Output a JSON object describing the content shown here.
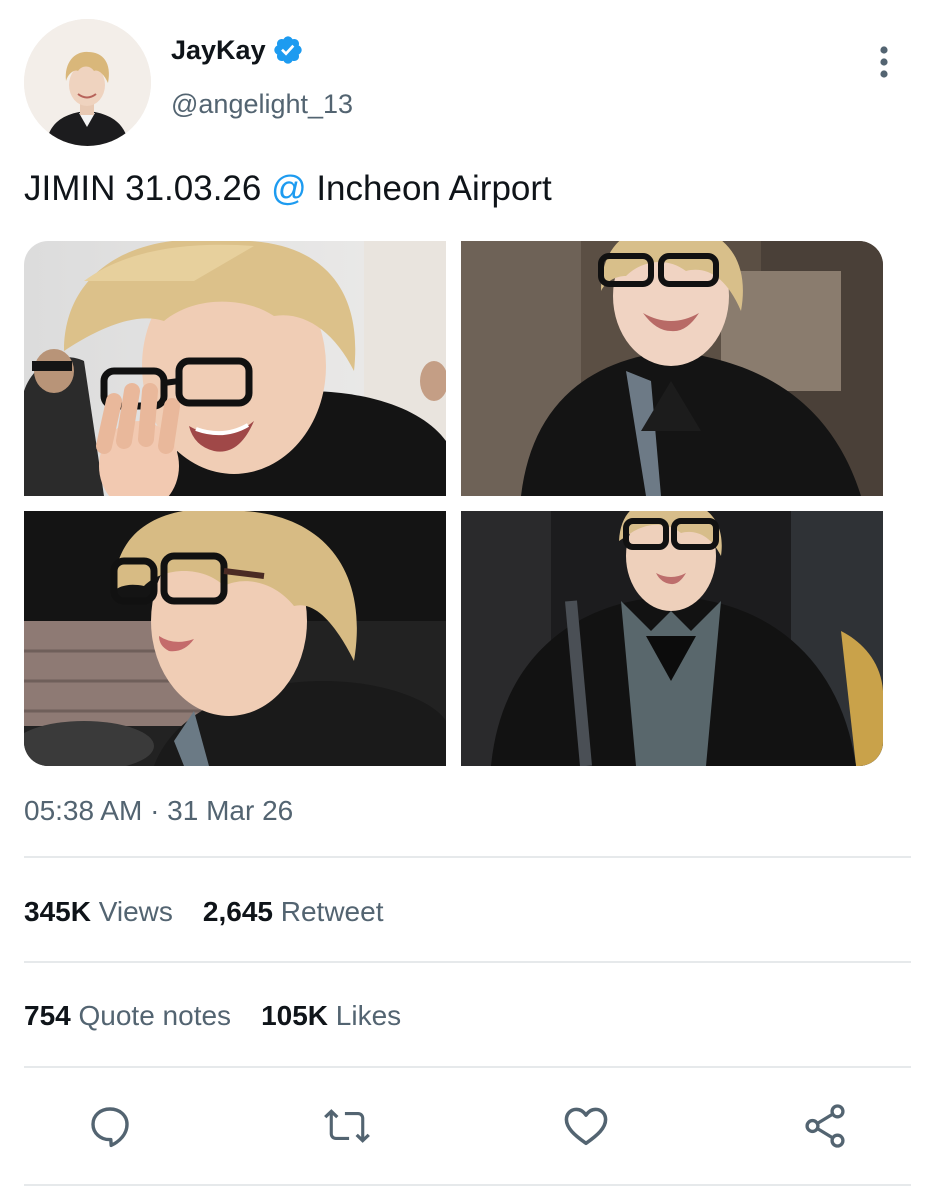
{
  "author": {
    "display_name": "JayKay",
    "handle": "@angelight_13",
    "verified": true
  },
  "tweet": {
    "text_before": "JIMIN 31.03.26 ",
    "at_symbol": "@",
    "text_after": " Incheon Airport",
    "timestamp": "05:38 AM · 31 Mar 26"
  },
  "media": [
    {
      "label": "photo-1"
    },
    {
      "label": "photo-2"
    },
    {
      "label": "photo-3"
    },
    {
      "label": "photo-4"
    }
  ],
  "stats": {
    "views_count": "345K",
    "views_label": "Views",
    "retweets_count": "2,645",
    "retweets_label": "Retweet",
    "quotes_count": "754",
    "quotes_label": "Quote notes",
    "likes_count": "105K",
    "likes_label": "Likes"
  },
  "actions": {
    "reply_icon": "reply-icon",
    "retweet_icon": "retweet-icon",
    "like_icon": "heart-icon",
    "share_icon": "share-icon"
  },
  "colors": {
    "accent": "#1d9bf0",
    "secondary_text": "#536471",
    "primary_text": "#0f1419",
    "divider": "#e6e9eb"
  }
}
